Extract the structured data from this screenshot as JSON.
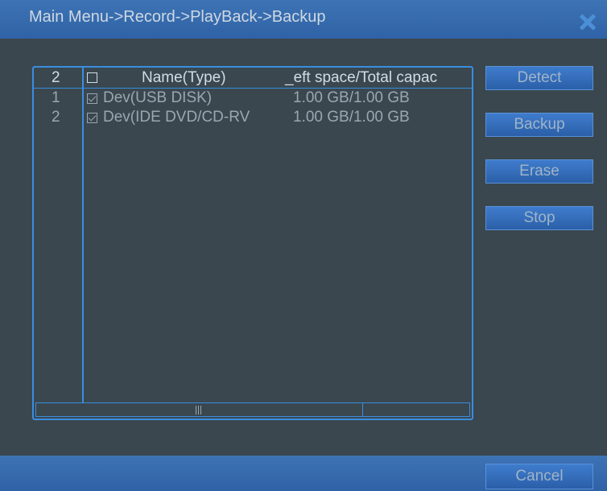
{
  "title": "Main Menu->Record->PlayBack->Backup",
  "table": {
    "header": {
      "count": "2",
      "name": "Name(Type)",
      "space": "_eft space/Total capac",
      "checked": false
    },
    "rows": [
      {
        "index": "1",
        "checked": true,
        "name": "Dev(USB DISK)",
        "space": "1.00 GB/1.00 GB"
      },
      {
        "index": "2",
        "checked": true,
        "name": "Dev(IDE DVD/CD-RV",
        "space": "1.00 GB/1.00 GB"
      }
    ]
  },
  "buttons": {
    "detect": "Detect",
    "backup": "Backup",
    "erase": "Erase",
    "stop": "Stop",
    "cancel": "Cancel"
  },
  "colors": {
    "title_bar": "#3571b3",
    "background": "#3a474e",
    "accent": "#3a8de0"
  }
}
